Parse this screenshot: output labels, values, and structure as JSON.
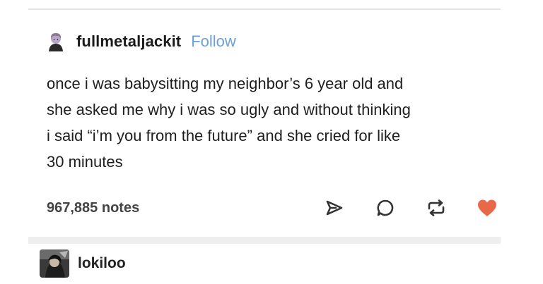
{
  "post": {
    "username": "fullmetaljackit",
    "follow_label": "Follow",
    "body_lines": [
      "once i was babysitting my neighbor’s 6 year old and",
      "she asked me why i was so ugly and without thinking",
      "i said “i’m you from the future” and she cried for like",
      "30 minutes"
    ],
    "notes": "967,885 notes",
    "actions": [
      {
        "icon": "share-icon"
      },
      {
        "icon": "reply-icon"
      },
      {
        "icon": "reblog-icon"
      },
      {
        "icon": "like-icon",
        "color": "#e8694a"
      }
    ]
  },
  "reblog": {
    "username": "lokiloo"
  },
  "colors": {
    "follow": "#6ba1d8",
    "like": "#e8694a",
    "divider": "#eeeeee"
  }
}
